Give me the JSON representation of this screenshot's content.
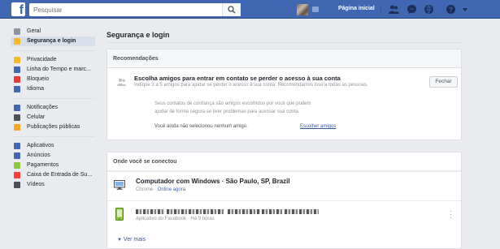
{
  "topbar": {
    "logo": "f",
    "search_placeholder": "Pesquisar",
    "home_label": "Página inicial",
    "icons": [
      "friends-icon",
      "messages-icon",
      "notifications-icon",
      "help-icon",
      "account-menu-icon"
    ]
  },
  "sidebar": {
    "groups": [
      [
        {
          "label": "Geral",
          "icon": "gear-icon",
          "active": false
        },
        {
          "label": "Segurança e login",
          "icon": "shield-icon",
          "active": true
        }
      ],
      [
        {
          "label": "Privacidade",
          "icon": "lock-icon"
        },
        {
          "label": "Linha do Tempo e marc...",
          "icon": "timeline-icon"
        },
        {
          "label": "Bloqueio",
          "icon": "block-icon"
        },
        {
          "label": "Idioma",
          "icon": "language-icon"
        }
      ],
      [
        {
          "label": "Notificações",
          "icon": "globe-icon"
        },
        {
          "label": "Celular",
          "icon": "mobile-icon"
        },
        {
          "label": "Publicações públicas",
          "icon": "rss-icon"
        }
      ],
      [
        {
          "label": "Aplicativos",
          "icon": "apps-icon"
        },
        {
          "label": "Anúncios",
          "icon": "ads-icon"
        },
        {
          "label": "Pagamentos",
          "icon": "payments-icon"
        },
        {
          "label": "Caixa de Entrada de Su...",
          "icon": "support-inbox-icon"
        },
        {
          "label": "Vídeos",
          "icon": "video-icon"
        }
      ]
    ]
  },
  "main": {
    "title": "Segurança e login",
    "recommendations": {
      "header": "Recomendações",
      "title": "Escolha amigos para entrar em contato se perder o acesso à sua conta",
      "subtitle": "Indique 3 a 5 amigos para ajudar se perder o acesso à sua conta. Recomendamos isso a todas as pessoas.",
      "close_label": "Fechar",
      "body_line1": "Seus contatos de confiança são amigos escolhidos por você que podem",
      "body_line2": "ajudar de forma segura se tiver problemas para acessar sua conta.",
      "none_selected": "Você ainda não selecionou nenhum amigo.",
      "choose_link": "Escolher amigos"
    },
    "connections": {
      "header": "Onde você se conectou",
      "items": [
        {
          "title": "Computador com Windows · São Paulo, SP, Brazil",
          "browser": "Chrome",
          "status": "Online agora",
          "device_icon": "desktop-icon"
        },
        {
          "title": "",
          "app": "Aplicativo do Facebook",
          "time": "Há 9 horas",
          "device_icon": "android-phone-icon"
        }
      ],
      "see_more": "Ver mais"
    }
  },
  "colors": {
    "brand": "#4267b2",
    "background": "#e9ebee",
    "link": "#365899",
    "active_sidebar": "#d8dfea"
  }
}
